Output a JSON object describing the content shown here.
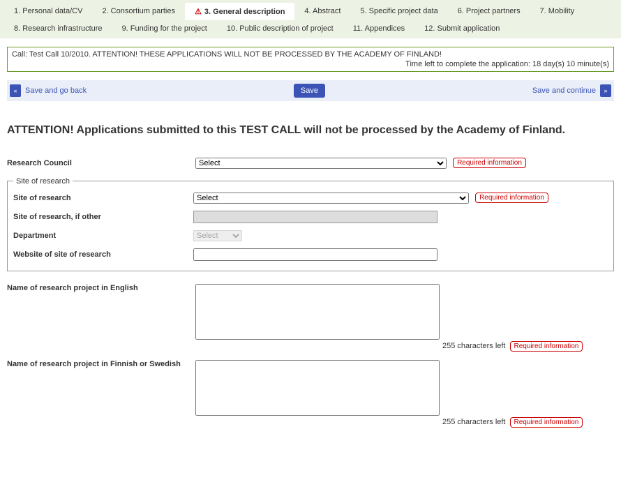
{
  "tabs": [
    {
      "label": "1. Personal data/CV"
    },
    {
      "label": "2. Consortium parties"
    },
    {
      "label": "3. General description",
      "active": true,
      "warn": true
    },
    {
      "label": "4. Abstract"
    },
    {
      "label": "5. Specific project data"
    },
    {
      "label": "6. Project partners"
    },
    {
      "label": "7. Mobility"
    },
    {
      "label": "8. Research infrastructure"
    },
    {
      "label": "9. Funding for the project"
    },
    {
      "label": "10. Public description of project"
    },
    {
      "label": "11. Appendices"
    },
    {
      "label": "12. Submit application"
    }
  ],
  "call_box": {
    "line1": "Call: Test Call 10/2010. ATTENTION! THESE APPLICATIONS WILL NOT BE PROCESSED BY THE ACADEMY OF FINLAND!",
    "line2": "Time left to complete the application: 18 day(s) 10 minute(s)"
  },
  "actions": {
    "back_label": "Save and go back",
    "save_label": "Save",
    "continue_label": "Save and continue",
    "prev_glyph": "«",
    "next_glyph": "»"
  },
  "attention_text": "ATTENTION! Applications submitted to this TEST CALL will not be processed by the Academy of Finland.",
  "labels": {
    "research_council": "Research Council",
    "site_fieldset": "Site of research",
    "site_of_research": "Site of research",
    "site_other": "Site of research, if other",
    "department": "Department",
    "website": "Website of site of research",
    "name_en": "Name of research project in English",
    "name_fi": "Name of research project in Finnish or Swedish",
    "required": "Required information",
    "chars_left": "255 characters left",
    "select_option": "Select"
  }
}
